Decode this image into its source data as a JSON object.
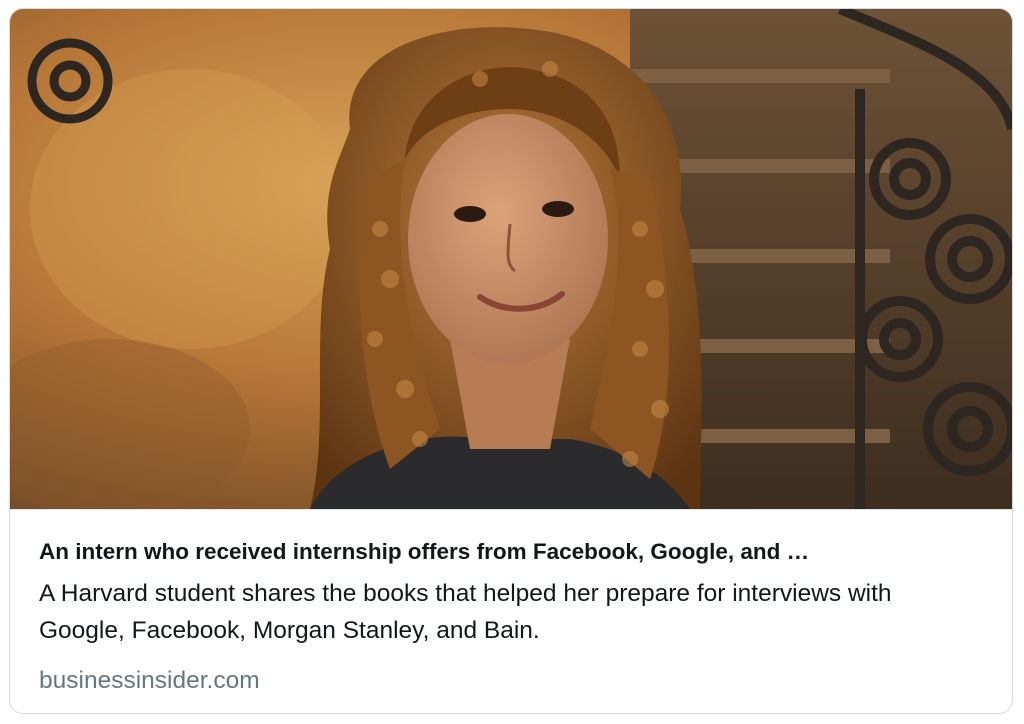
{
  "card": {
    "title": "An intern who received internship offers from Facebook, Google, and …",
    "description": "A Harvard student shares the books that helped her prepare for interviews with Google, Facebook, Morgan Stanley, and Bain.",
    "domain": "businessinsider.com"
  },
  "image": {
    "subject": "portrait-photo",
    "palette": {
      "wall": "#b0702e",
      "wall_light": "#d49a4e",
      "hair": "#7a4718",
      "hair_highlight": "#c98a45",
      "skin": "#c58a62",
      "shirt": "#2b2a2c",
      "stairs": "#5c4630",
      "iron": "#2e2620"
    }
  },
  "colors": {
    "title_text": "#14171a",
    "domain_text": "#657786",
    "border": "#d5dbe0"
  }
}
